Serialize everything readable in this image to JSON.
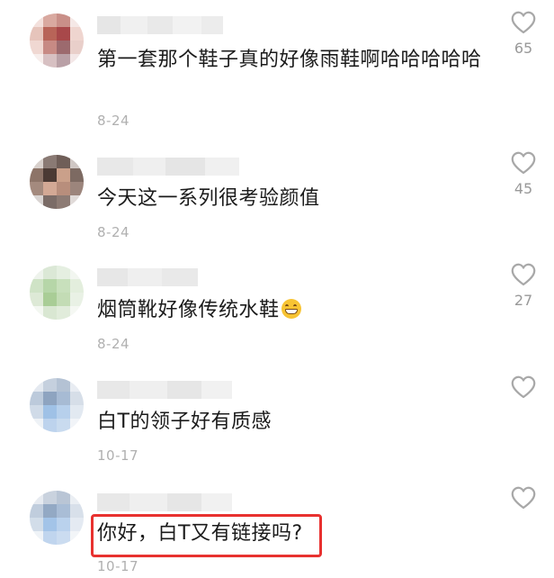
{
  "comments": [
    {
      "text": "第一套那个鞋子真的好像雨鞋啊哈哈哈哈哈",
      "date": "8-24",
      "likes": "65"
    },
    {
      "text": "今天这一系列很考验颜值",
      "date": "8-24",
      "likes": "45"
    },
    {
      "text": "烟筒靴好像传统水鞋",
      "date": "8-24",
      "likes": "27",
      "emoji": "grinning-face-emoji"
    },
    {
      "text": "白T的领子好有质感",
      "date": "10-17",
      "likes": ""
    },
    {
      "text": "你好，白T又有链接吗?",
      "date": "10-17",
      "likes": "",
      "highlighted": true
    }
  ],
  "colors": {
    "text": "#1b1b1b",
    "meta": "#b0b0b0",
    "like_count": "#999999",
    "highlight_border": "#e8312f"
  },
  "icons": {
    "like": "heart-outline-icon"
  }
}
